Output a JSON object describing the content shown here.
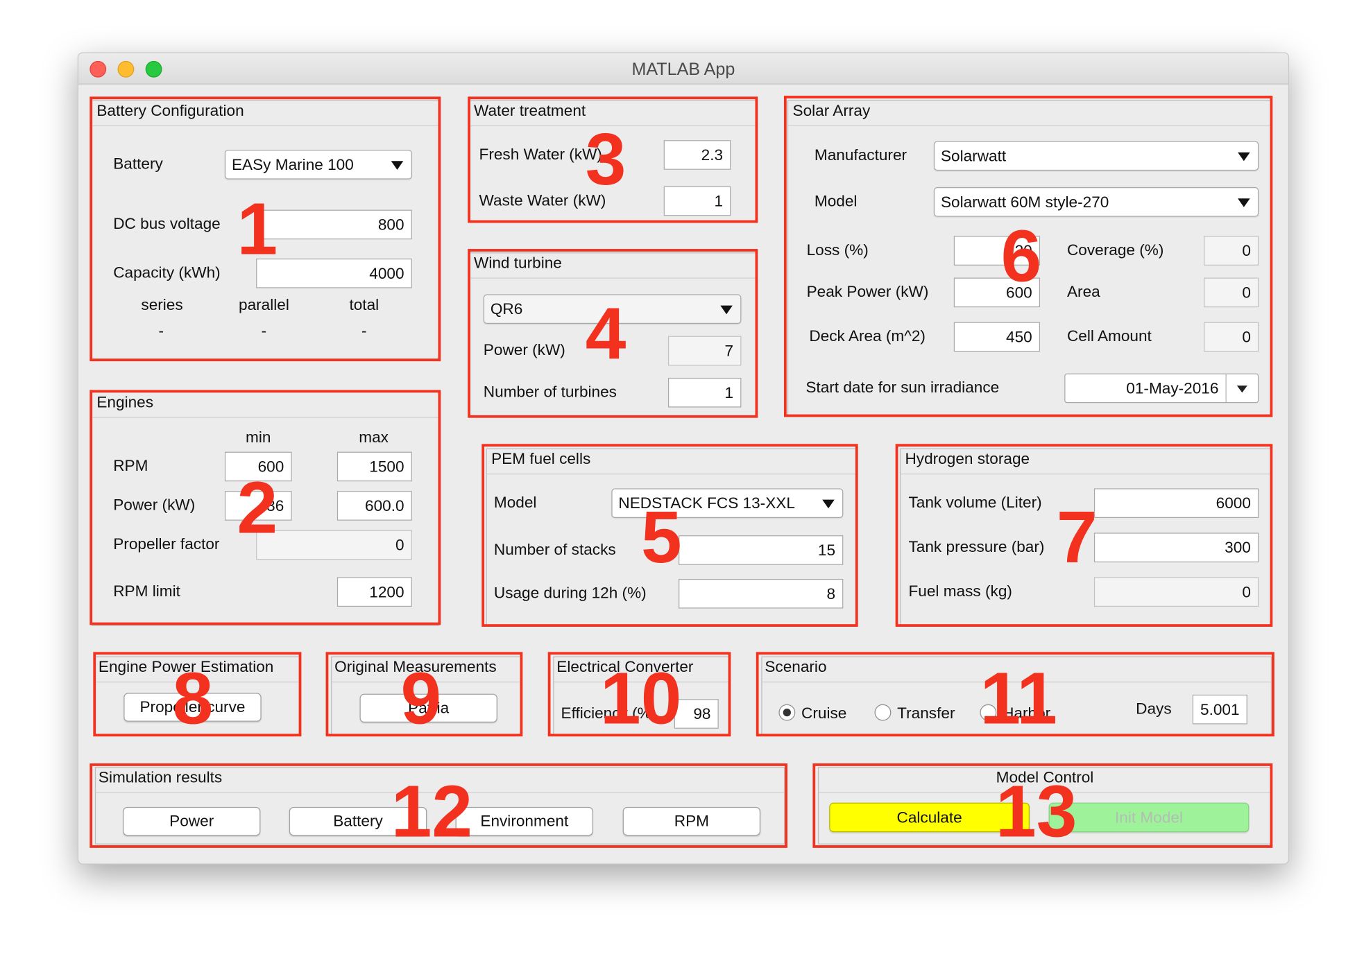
{
  "window": {
    "title": "MATLAB App",
    "traffic_lights": {
      "close": "#fe5f57",
      "minimize": "#febc2e",
      "zoom": "#28c840"
    }
  },
  "battery": {
    "title": "Battery Configuration",
    "battery_label": "Battery",
    "battery_value": "EASy Marine 100",
    "dc_label": "DC bus voltage",
    "dc_value": "800",
    "capacity_label": "Capacity (kWh)",
    "capacity_value": "4000",
    "series_label": "series",
    "parallel_label": "parallel",
    "total_label": "total",
    "series_value": "-",
    "parallel_value": "-",
    "total_value": "-"
  },
  "engines": {
    "title": "Engines",
    "min_label": "min",
    "max_label": "max",
    "rpm_label": "RPM",
    "rpm_min": "600",
    "rpm_max": "1500",
    "power_label": "Power (kW)",
    "power_min": "36",
    "power_max": "600.0",
    "propeller_label": "Propeller factor",
    "propeller_value": "0",
    "rpm_limit_label": "RPM limit",
    "rpm_limit_value": "1200"
  },
  "water": {
    "title": "Water treatment",
    "fresh_label": "Fresh Water (kW)",
    "fresh_value": "2.3",
    "waste_label": "Waste Water (kW)",
    "waste_value": "1"
  },
  "wind": {
    "title": "Wind turbine",
    "model_value": "QR6",
    "power_label": "Power (kW)",
    "power_value": "7",
    "turbines_label": "Number of turbines",
    "turbines_value": "1"
  },
  "solar": {
    "title": "Solar Array",
    "manufacturer_label": "Manufacturer",
    "manufacturer_value": "Solarwatt",
    "model_label": "Model",
    "model_value": "Solarwatt 60M style-270",
    "loss_label": "Loss (%)",
    "loss_value": "20",
    "peak_label": "Peak Power (kW)",
    "peak_value": "600",
    "deck_label": "Deck Area (m^2)",
    "deck_value": "450",
    "coverage_label": "Coverage (%)",
    "coverage_value": "0",
    "area_label": "Area",
    "area_value": "0",
    "cell_label": "Cell Amount",
    "cell_value": "0",
    "start_label": "Start date for sun irradiance",
    "start_value": "01-May-2016"
  },
  "pem": {
    "title": "PEM fuel cells",
    "model_label": "Model",
    "model_value": "NEDSTACK FCS 13-XXL",
    "stacks_label": "Number of stacks",
    "stacks_value": "15",
    "usage_label": "Usage during 12h (%)",
    "usage_value": "8"
  },
  "hydrogen": {
    "title": "Hydrogen storage",
    "tank_volume_label": "Tank volume (Liter)",
    "tank_volume_value": "6000",
    "tank_pressure_label": "Tank pressure (bar)",
    "tank_pressure_value": "300",
    "fuel_mass_label": "Fuel mass (kg)",
    "fuel_mass_value": "0"
  },
  "engine_power": {
    "title": "Engine Power Estimation",
    "button": "Propeller curve"
  },
  "original": {
    "title": "Original Measurements",
    "button": "Patria"
  },
  "converter": {
    "title": "Electrical Converter",
    "efficiency_label": "Efficiency (%)",
    "efficiency_value": "98"
  },
  "scenario": {
    "title": "Scenario",
    "options": [
      "Cruise",
      "Transfer",
      "Harbor"
    ],
    "selected": "Cruise",
    "days_label": "Days",
    "days_value": "5.001"
  },
  "simulation": {
    "title": "Simulation results",
    "buttons": [
      "Power",
      "Battery",
      "Environment",
      "RPM"
    ]
  },
  "model_control": {
    "title": "Model Control",
    "calculate": "Calculate",
    "init": "Init Model",
    "calculate_color": "#ffff00",
    "init_color": "#9ef29a"
  },
  "annotations": [
    "1",
    "2",
    "3",
    "4",
    "5",
    "6",
    "7",
    "8",
    "9",
    "10",
    "11",
    "12",
    "13"
  ],
  "annotation_color": "#f2311f"
}
